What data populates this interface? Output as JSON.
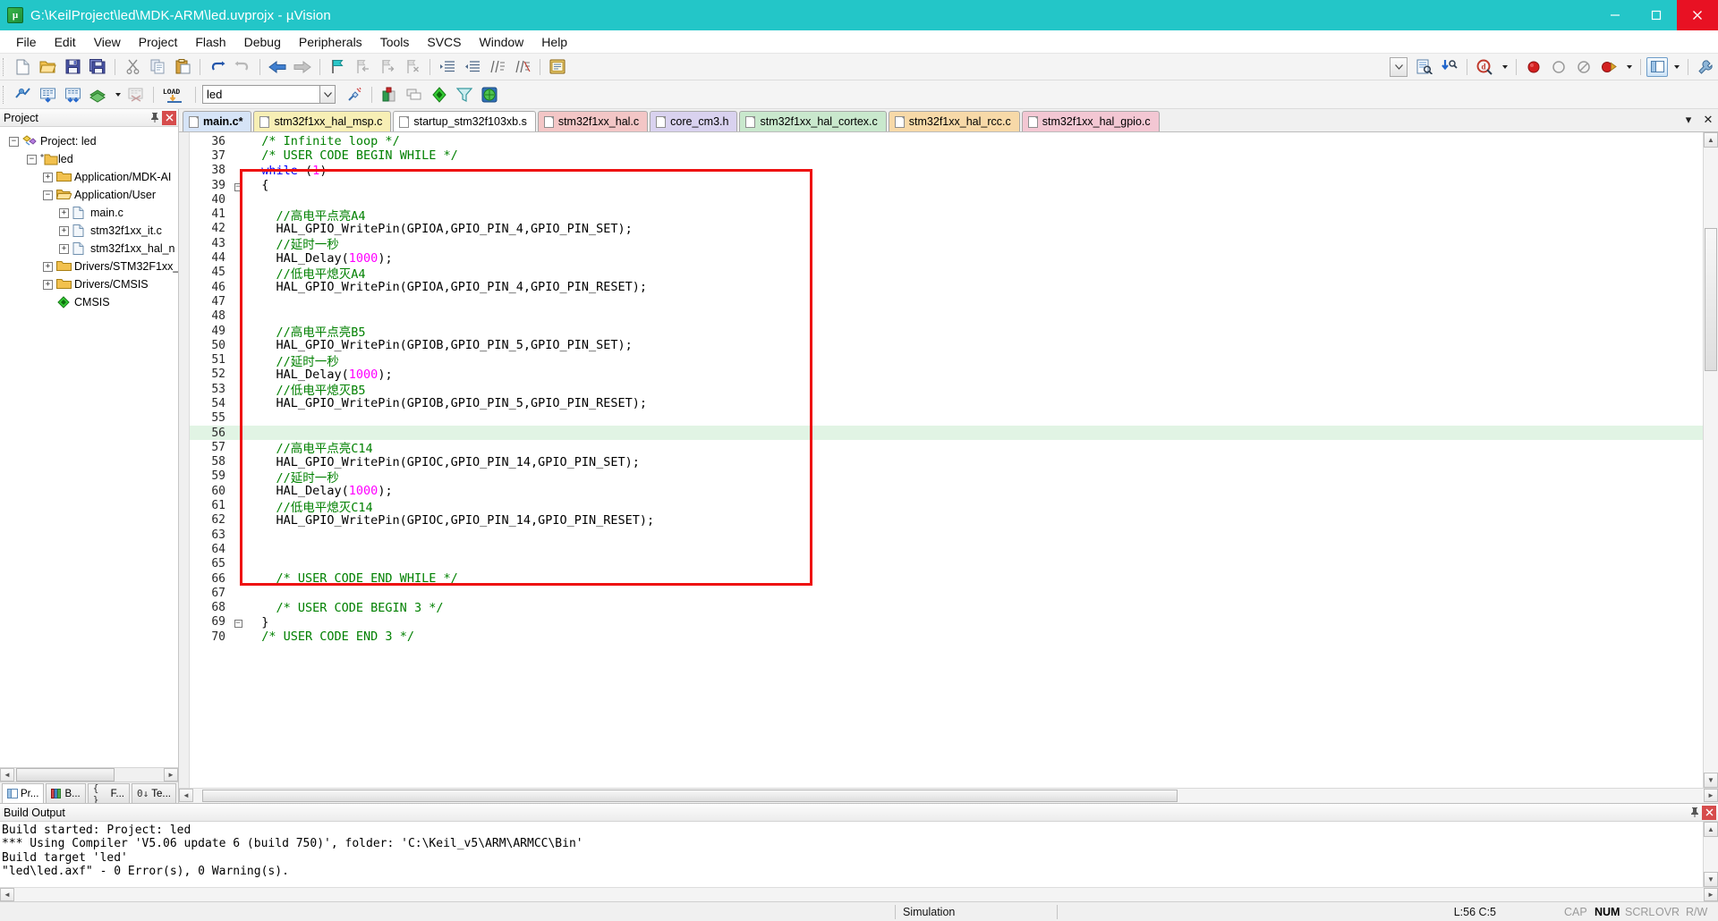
{
  "window": {
    "title": "G:\\KeilProject\\led\\MDK-ARM\\led.uvprojx - µVision",
    "app_icon": "uvision-icon",
    "minimize": "minimize-button",
    "maximize": "maximize-button",
    "close": "close-button"
  },
  "menu": {
    "items": [
      {
        "label": "File"
      },
      {
        "label": "Edit"
      },
      {
        "label": "View"
      },
      {
        "label": "Project"
      },
      {
        "label": "Flash"
      },
      {
        "label": "Debug"
      },
      {
        "label": "Peripherals"
      },
      {
        "label": "Tools"
      },
      {
        "label": "SVCS"
      },
      {
        "label": "Window"
      },
      {
        "label": "Help"
      }
    ]
  },
  "toolbar_file": {
    "buttons": [
      {
        "name": "new-file-icon",
        "tip": "New"
      },
      {
        "name": "open-file-icon",
        "tip": "Open"
      },
      {
        "name": "save-icon",
        "tip": "Save"
      },
      {
        "name": "save-all-icon",
        "tip": "Save All"
      },
      {
        "name": "cut-icon",
        "tip": "Cut"
      },
      {
        "name": "copy-icon",
        "tip": "Copy"
      },
      {
        "name": "paste-icon",
        "tip": "Paste"
      },
      {
        "name": "undo-icon",
        "tip": "Undo"
      },
      {
        "name": "redo-icon",
        "tip": "Redo"
      },
      {
        "name": "navigate-back-icon",
        "tip": "Back"
      },
      {
        "name": "navigate-forward-icon",
        "tip": "Forward"
      },
      {
        "name": "bookmark-toggle-icon",
        "tip": "Insert/Remove Bookmark"
      },
      {
        "name": "bookmark-prev-icon",
        "tip": "Previous Bookmark"
      },
      {
        "name": "bookmark-next-icon",
        "tip": "Next Bookmark"
      },
      {
        "name": "bookmark-clear-icon",
        "tip": "Clear All Bookmarks"
      },
      {
        "name": "indent-right-icon",
        "tip": "Indent"
      },
      {
        "name": "indent-left-icon",
        "tip": "Outdent"
      },
      {
        "name": "comment-icon",
        "tip": "Comment"
      },
      {
        "name": "uncomment-icon",
        "tip": "Uncomment"
      },
      {
        "name": "configure-icon",
        "tip": "Configuration Wizard"
      }
    ],
    "right_buttons": [
      {
        "name": "find-combo-dropdown-icon",
        "tip": "Find Combo"
      },
      {
        "name": "find-in-files-icon",
        "tip": "Find in Files"
      },
      {
        "name": "incremental-find-icon",
        "tip": "Incremental Find"
      },
      {
        "name": "debug-start-icon",
        "tip": "Start/Stop Debug Session"
      },
      {
        "name": "debug-dropdown-icon",
        "tip": "Debug Options"
      },
      {
        "name": "breakpoint-icon",
        "tip": "Insert/Remove Breakpoint"
      }
    ]
  },
  "toolbar_build": {
    "buttons": [
      {
        "name": "translate-icon",
        "tip": "Translate"
      },
      {
        "name": "build-icon",
        "tip": "Build"
      },
      {
        "name": "rebuild-icon",
        "tip": "Rebuild"
      },
      {
        "name": "batch-build-icon",
        "tip": "Batch Build"
      },
      {
        "name": "batch-build-dropdown-icon",
        "tip": "Batch Build Options"
      },
      {
        "name": "stop-build-icon",
        "tip": "Stop Build"
      },
      {
        "name": "download-icon",
        "tip": "Download"
      }
    ],
    "target_value": "led",
    "target_placeholder": "Select Target",
    "right_buttons": [
      {
        "name": "target-options-icon",
        "tip": "Options for Target"
      },
      {
        "name": "manage-runtime-icon",
        "tip": "Manage Run-Time Environment"
      },
      {
        "name": "manage-project-items-icon",
        "tip": "Manage Project Items"
      },
      {
        "name": "multi-project-icon",
        "tip": "Multi-Project"
      },
      {
        "name": "filter-icon",
        "tip": "Filter"
      },
      {
        "name": "pack-installer-icon",
        "tip": "Pack Installer"
      }
    ]
  },
  "project_panel": {
    "header": "Project",
    "pin_icon": "pin-icon",
    "close_icon": "close-icon",
    "tree": [
      {
        "depth": 0,
        "expander": "-",
        "icon": "project-icon",
        "label": "Project: led"
      },
      {
        "depth": 1,
        "expander": "-",
        "icon": "target-folder-icon",
        "label": "led"
      },
      {
        "depth": 2,
        "expander": "+",
        "icon": "group-folder-icon",
        "label": "Application/MDK-AI"
      },
      {
        "depth": 2,
        "expander": "-",
        "icon": "group-folder-open-icon",
        "label": "Application/User"
      },
      {
        "depth": 3,
        "expander": "+",
        "icon": "c-file-icon",
        "label": "main.c"
      },
      {
        "depth": 3,
        "expander": "+",
        "icon": "c-file-icon",
        "label": "stm32f1xx_it.c"
      },
      {
        "depth": 3,
        "expander": "+",
        "icon": "c-file-icon",
        "label": "stm32f1xx_hal_n"
      },
      {
        "depth": 2,
        "expander": "+",
        "icon": "group-folder-icon",
        "label": "Drivers/STM32F1xx_"
      },
      {
        "depth": 2,
        "expander": "+",
        "icon": "group-folder-icon",
        "label": "Drivers/CMSIS"
      },
      {
        "depth": 2,
        "expander": "",
        "icon": "cmsis-pack-icon",
        "label": "CMSIS"
      }
    ],
    "tabs": [
      {
        "label": "Pr...",
        "icon": "project-tab-icon",
        "active": true
      },
      {
        "label": "B...",
        "icon": "books-tab-icon",
        "active": false
      },
      {
        "label": "F...",
        "icon": "functions-tab-icon",
        "active": false
      },
      {
        "label": "Te...",
        "icon": "templates-tab-icon",
        "active": false
      }
    ]
  },
  "editor": {
    "tabs": [
      {
        "label": "main.c*",
        "active": true,
        "color": "#d6e4f7"
      },
      {
        "label": "stm32f1xx_hal_msp.c",
        "active": false,
        "color": "#f7efb5"
      },
      {
        "label": "startup_stm32f103xb.s",
        "active": false,
        "color": "#ffffff"
      },
      {
        "label": "stm32f1xx_hal.c",
        "active": false,
        "color": "#f3c6c6"
      },
      {
        "label": "core_cm3.h",
        "active": false,
        "color": "#d9d2ef"
      },
      {
        "label": "stm32f1xx_hal_cortex.c",
        "active": false,
        "color": "#c9e8cd"
      },
      {
        "label": "stm32f1xx_hal_rcc.c",
        "active": false,
        "color": "#f7d9a8"
      },
      {
        "label": "stm32f1xx_hal_gpio.c",
        "active": false,
        "color": "#f3c7d3"
      }
    ],
    "tab_scroll_left": "chevron-left-icon",
    "tab_scroll_right": "chevron-right-icon",
    "tab_close": "close-icon",
    "highlight_line": 56,
    "code": [
      {
        "n": 36,
        "fold": "",
        "tokens": [
          {
            "t": "  ",
            "c": "pln"
          },
          {
            "t": "/* Infinite loop */",
            "c": "cmt"
          }
        ]
      },
      {
        "n": 37,
        "fold": "",
        "tokens": [
          {
            "t": "  ",
            "c": "pln"
          },
          {
            "t": "/* USER CODE BEGIN WHILE */",
            "c": "cmt"
          }
        ]
      },
      {
        "n": 38,
        "fold": "",
        "tokens": [
          {
            "t": "  ",
            "c": "pln"
          },
          {
            "t": "while",
            "c": "kw"
          },
          {
            "t": " (",
            "c": "pln"
          },
          {
            "t": "1",
            "c": "num"
          },
          {
            "t": ")",
            "c": "pln"
          }
        ]
      },
      {
        "n": 39,
        "fold": "-",
        "tokens": [
          {
            "t": "  {",
            "c": "pln"
          }
        ]
      },
      {
        "n": 40,
        "fold": "",
        "tokens": []
      },
      {
        "n": 41,
        "fold": "",
        "tokens": [
          {
            "t": "    ",
            "c": "pln"
          },
          {
            "t": "//高电平点亮A4",
            "c": "cmt"
          }
        ]
      },
      {
        "n": 42,
        "fold": "",
        "tokens": [
          {
            "t": "    HAL_GPIO_WritePin(GPIOA,GPIO_PIN_4,GPIO_PIN_SET);",
            "c": "pln"
          }
        ]
      },
      {
        "n": 43,
        "fold": "",
        "tokens": [
          {
            "t": "    ",
            "c": "pln"
          },
          {
            "t": "//延时一秒",
            "c": "cmt"
          }
        ]
      },
      {
        "n": 44,
        "fold": "",
        "tokens": [
          {
            "t": "    HAL_Delay(",
            "c": "pln"
          },
          {
            "t": "1000",
            "c": "num"
          },
          {
            "t": ");",
            "c": "pln"
          }
        ]
      },
      {
        "n": 45,
        "fold": "",
        "tokens": [
          {
            "t": "    ",
            "c": "pln"
          },
          {
            "t": "//低电平熄灭A4",
            "c": "cmt"
          }
        ]
      },
      {
        "n": 46,
        "fold": "",
        "tokens": [
          {
            "t": "    HAL_GPIO_WritePin(GPIOA,GPIO_PIN_4,GPIO_PIN_RESET);",
            "c": "pln"
          }
        ]
      },
      {
        "n": 47,
        "fold": "",
        "tokens": []
      },
      {
        "n": 48,
        "fold": "",
        "tokens": []
      },
      {
        "n": 49,
        "fold": "",
        "tokens": [
          {
            "t": "    ",
            "c": "pln"
          },
          {
            "t": "//高电平点亮B5",
            "c": "cmt"
          }
        ]
      },
      {
        "n": 50,
        "fold": "",
        "tokens": [
          {
            "t": "    HAL_GPIO_WritePin(GPIOB,GPIO_PIN_5,GPIO_PIN_SET);",
            "c": "pln"
          }
        ]
      },
      {
        "n": 51,
        "fold": "",
        "tokens": [
          {
            "t": "    ",
            "c": "pln"
          },
          {
            "t": "//延时一秒",
            "c": "cmt"
          }
        ]
      },
      {
        "n": 52,
        "fold": "",
        "tokens": [
          {
            "t": "    HAL_Delay(",
            "c": "pln"
          },
          {
            "t": "1000",
            "c": "num"
          },
          {
            "t": ");",
            "c": "pln"
          }
        ]
      },
      {
        "n": 53,
        "fold": "",
        "tokens": [
          {
            "t": "    ",
            "c": "pln"
          },
          {
            "t": "//低电平熄灭B5",
            "c": "cmt"
          }
        ]
      },
      {
        "n": 54,
        "fold": "",
        "tokens": [
          {
            "t": "    HAL_GPIO_WritePin(GPIOB,GPIO_PIN_5,GPIO_PIN_RESET);",
            "c": "pln"
          }
        ]
      },
      {
        "n": 55,
        "fold": "",
        "tokens": []
      },
      {
        "n": 56,
        "fold": "",
        "tokens": []
      },
      {
        "n": 57,
        "fold": "",
        "tokens": [
          {
            "t": "    ",
            "c": "pln"
          },
          {
            "t": "//高电平点亮C14",
            "c": "cmt"
          }
        ]
      },
      {
        "n": 58,
        "fold": "",
        "tokens": [
          {
            "t": "    HAL_GPIO_WritePin(GPIOC,GPIO_PIN_14,GPIO_PIN_SET);",
            "c": "pln"
          }
        ]
      },
      {
        "n": 59,
        "fold": "",
        "tokens": [
          {
            "t": "    ",
            "c": "pln"
          },
          {
            "t": "//延时一秒",
            "c": "cmt"
          }
        ]
      },
      {
        "n": 60,
        "fold": "",
        "tokens": [
          {
            "t": "    HAL_Delay(",
            "c": "pln"
          },
          {
            "t": "1000",
            "c": "num"
          },
          {
            "t": ");",
            "c": "pln"
          }
        ]
      },
      {
        "n": 61,
        "fold": "",
        "tokens": [
          {
            "t": "    ",
            "c": "pln"
          },
          {
            "t": "//低电平熄灭C14",
            "c": "cmt"
          }
        ]
      },
      {
        "n": 62,
        "fold": "",
        "tokens": [
          {
            "t": "    HAL_GPIO_WritePin(GPIOC,GPIO_PIN_14,GPIO_PIN_RESET);",
            "c": "pln"
          }
        ]
      },
      {
        "n": 63,
        "fold": "",
        "tokens": []
      },
      {
        "n": 64,
        "fold": "",
        "tokens": []
      },
      {
        "n": 65,
        "fold": "",
        "tokens": []
      },
      {
        "n": 66,
        "fold": "",
        "tokens": [
          {
            "t": "    ",
            "c": "pln"
          },
          {
            "t": "/* USER CODE END WHILE */",
            "c": "cmt"
          }
        ]
      },
      {
        "n": 67,
        "fold": "",
        "tokens": []
      },
      {
        "n": 68,
        "fold": "",
        "tokens": [
          {
            "t": "    ",
            "c": "pln"
          },
          {
            "t": "/* USER CODE BEGIN 3 */",
            "c": "cmt"
          }
        ]
      },
      {
        "n": 69,
        "fold": "-",
        "tokens": [
          {
            "t": "  }",
            "c": "pln"
          }
        ]
      },
      {
        "n": 70,
        "fold": "",
        "tokens": [
          {
            "t": "  ",
            "c": "pln"
          },
          {
            "t": "/* USER CODE END 3 */",
            "c": "cmt"
          }
        ]
      }
    ],
    "annotation": {
      "name": "red-highlight-box",
      "color": "#ee1111"
    }
  },
  "build_output": {
    "header": "Build Output",
    "pin_icon": "pin-icon",
    "close_icon": "close-icon",
    "lines": [
      "Build started: Project: led",
      "*** Using Compiler 'V5.06 update 6 (build 750)', folder: 'C:\\Keil_v5\\ARM\\ARMCC\\Bin'",
      "Build target 'led'",
      "\"led\\led.axf\" - 0 Error(s), 0 Warning(s)."
    ]
  },
  "statusbar": {
    "simulation": "Simulation",
    "position": "L:56 C:5",
    "indicators": [
      {
        "label": "CAP",
        "active": false
      },
      {
        "label": "NUM",
        "active": true
      },
      {
        "label": "SCRL",
        "active": false
      },
      {
        "label": "OVR",
        "active": false
      },
      {
        "label": "R/W",
        "active": false
      }
    ]
  },
  "colors": {
    "titlebar": "#23c6c8",
    "close_button": "#e81123",
    "accent_red": "#ee1111",
    "highlight_line": "#e1f4e4",
    "comment": "#008000",
    "keyword": "#0000ff",
    "number": "#ff00ff"
  }
}
